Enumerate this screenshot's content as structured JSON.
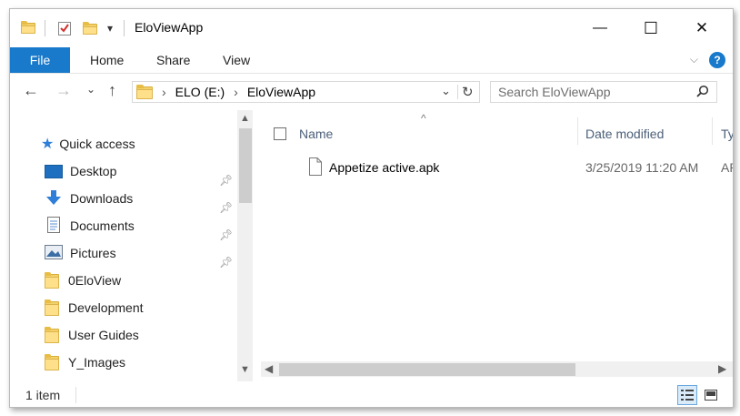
{
  "window": {
    "title": "EloViewApp",
    "minimize_glyph": "—",
    "maximize_glyph": "☐",
    "close_glyph": "✕"
  },
  "quick_access_toolbar": {
    "dropdown_glyph": "▾"
  },
  "ribbon": {
    "tabs": [
      {
        "label": "File"
      },
      {
        "label": "Home"
      },
      {
        "label": "Share"
      },
      {
        "label": "View"
      }
    ],
    "expand_glyph": "⌵",
    "help_glyph": "?"
  },
  "navigation": {
    "back_glyph": "←",
    "forward_glyph": "→",
    "recent_glyph": "⌄",
    "up_glyph": "↑",
    "breadcrumb": [
      {
        "label": "ELO (E:)"
      },
      {
        "label": "EloViewApp"
      }
    ],
    "separator_glyph": "›",
    "address_dropdown_glyph": "⌄",
    "refresh_glyph": "↻",
    "search_placeholder": "Search EloViewApp"
  },
  "nav_pane": {
    "quick_access_label": "Quick access",
    "items": [
      {
        "label": "Desktop",
        "icon": "desktop-icon",
        "pinned": true
      },
      {
        "label": "Downloads",
        "icon": "downloads-icon",
        "pinned": true
      },
      {
        "label": "Documents",
        "icon": "documents-icon",
        "pinned": true
      },
      {
        "label": "Pictures",
        "icon": "pictures-icon",
        "pinned": true
      },
      {
        "label": "0EloView",
        "icon": "folder-icon",
        "pinned": false
      },
      {
        "label": "Development",
        "icon": "folder-icon",
        "pinned": false
      },
      {
        "label": "User Guides",
        "icon": "folder-icon",
        "pinned": false
      },
      {
        "label": "Y_Images",
        "icon": "folder-icon",
        "pinned": false
      }
    ]
  },
  "file_list": {
    "columns": [
      {
        "label": "Name"
      },
      {
        "label": "Date modified"
      },
      {
        "label": "Typ"
      }
    ],
    "sort_glyph": "^",
    "files": [
      {
        "name": "Appetize active.apk",
        "date_modified": "3/25/2019 11:20 AM",
        "type": "AP"
      }
    ]
  },
  "status_bar": {
    "item_count": "1 item"
  },
  "colors": {
    "accent": "#1979ca",
    "folder": "#ffe08a",
    "header_text": "#4c607a"
  }
}
